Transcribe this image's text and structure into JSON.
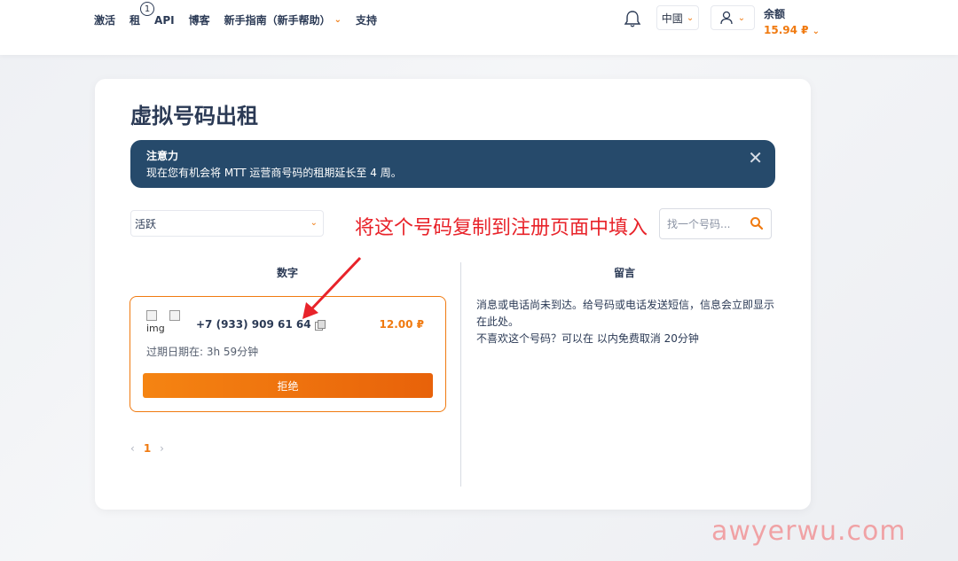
{
  "nav": {
    "items": [
      {
        "label": "激活"
      },
      {
        "label": "租"
      },
      {
        "label": "API"
      },
      {
        "label": "博客"
      },
      {
        "label": "新手指南（新手帮助）"
      },
      {
        "label": "支持"
      }
    ],
    "rent_badge": "1"
  },
  "header": {
    "language": "中國",
    "balance_label": "余额",
    "balance_value": "15.94 ₽"
  },
  "page": {
    "title": "虚拟号码出租"
  },
  "alert": {
    "title": "注意力",
    "message": "现在您有机会将 MTT 运营商号码的租期延长至 4 周。",
    "close": "✕"
  },
  "filter": {
    "selected": "活跃"
  },
  "search": {
    "placeholder": "找一个号码..."
  },
  "annotation": "将这个号码复制到注册页面中填入",
  "columns": {
    "numbers": "数字",
    "messages": "留言"
  },
  "rental": {
    "flag_alt": "img",
    "phone": "+7 (933) 909 61 64",
    "price": "12.00 ₽",
    "expires": "过期日期在: 3h 59分钟",
    "reject_label": "拒绝"
  },
  "pagination": {
    "prev": "‹",
    "current": "1",
    "next": "›"
  },
  "messages": {
    "line1": "消息或电话尚未到达。给号码或电话发送短信，信息会立即显示在此处。",
    "line2": "不喜欢这个号码？可以在 以内免费取消 20分钟"
  },
  "watermark": "awyerwu.com",
  "colors": {
    "accent": "#f07a10",
    "alert_bg": "#264a6b",
    "annotation": "#e8232a"
  }
}
